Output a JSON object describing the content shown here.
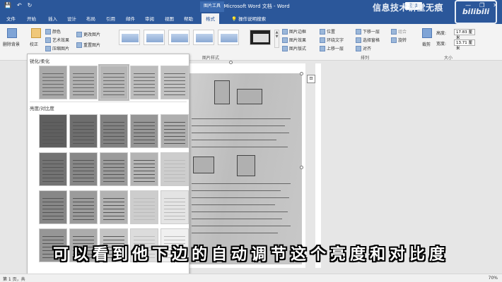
{
  "titlebar": {
    "doc_title": "新建 Microsoft Word 文档 - Word",
    "context_tab": "图片工具",
    "login": "登录",
    "qat_save": "💾",
    "qat_undo": "↶",
    "qat_redo": "↻",
    "win_min": "—",
    "win_restore": "❐",
    "win_close": "✕"
  },
  "tabs": [
    "文件",
    "开始",
    "插入",
    "设计",
    "布局",
    "引用",
    "邮件",
    "审阅",
    "视图",
    "帮助",
    "格式"
  ],
  "tell_me": "操作说明搜索",
  "watermark": "信息技术讲堂无痕",
  "bilibili": "bilibili",
  "ribbon": {
    "remove_bg": "删除背景",
    "correct": "校正",
    "color": "颜色",
    "artistic": "艺术效果",
    "compress": "压缩图片",
    "change_pic": "更改图片",
    "reset_pic": "重置图片",
    "pic_border": "图片边框",
    "pic_effects": "图片效果",
    "pic_layout": "图片版式",
    "pic_styles_label": "图片样式",
    "position": "位置",
    "wrap_text": "环绕文字",
    "bring_forward": "上移一层",
    "send_backward": "下移一层",
    "selection_pane": "选择窗格",
    "align": "对齐",
    "group": "组合",
    "rotate": "旋转",
    "arrange_label": "排列",
    "crop": "裁剪",
    "height_label": "高度:",
    "height_value": "17.83 厘米",
    "width_label": "宽度:",
    "width_value": "13.71 厘米",
    "size_label": "大小"
  },
  "gallery": {
    "sharpen_header": "锐化/柔化",
    "brightness_header": "亮度/对比度"
  },
  "status": {
    "page": "第 1 页，共",
    "zoom": "70%"
  },
  "subtitle": "可以看到他下边的自动调节这个亮度和对比度"
}
